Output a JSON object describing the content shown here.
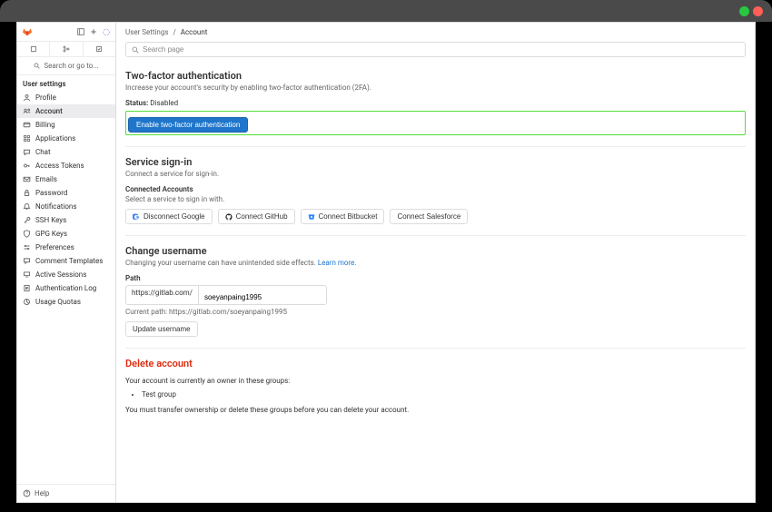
{
  "breadcrumb": {
    "root": "User Settings",
    "current": "Account"
  },
  "search": {
    "placeholder": "Search page"
  },
  "sidebar": {
    "search_label": "Search or go to...",
    "section_label": "User settings",
    "items": [
      {
        "label": "Profile"
      },
      {
        "label": "Account"
      },
      {
        "label": "Billing"
      },
      {
        "label": "Applications"
      },
      {
        "label": "Chat"
      },
      {
        "label": "Access Tokens"
      },
      {
        "label": "Emails"
      },
      {
        "label": "Password"
      },
      {
        "label": "Notifications"
      },
      {
        "label": "SSH Keys"
      },
      {
        "label": "GPG Keys"
      },
      {
        "label": "Preferences"
      },
      {
        "label": "Comment Templates"
      },
      {
        "label": "Active Sessions"
      },
      {
        "label": "Authentication Log"
      },
      {
        "label": "Usage Quotas"
      }
    ],
    "help_label": "Help"
  },
  "twofa": {
    "title": "Two-factor authentication",
    "desc": "Increase your account's security by enabling two-factor authentication (2FA).",
    "status_label": "Status:",
    "status_value": "Disabled",
    "enable_btn": "Enable two-factor authentication"
  },
  "signin": {
    "title": "Service sign-in",
    "desc": "Connect a service for sign-in.",
    "connected_title": "Connected Accounts",
    "connected_desc": "Select a service to sign in with.",
    "google": "Disconnect Google",
    "github": "Connect GitHub",
    "bitbucket": "Connect Bitbucket",
    "salesforce": "Connect Salesforce"
  },
  "username": {
    "title": "Change username",
    "desc_a": "Changing your username can have unintended side effects.",
    "desc_link": "Learn more",
    "field_label": "Path",
    "prefix": "https://gitlab.com/",
    "value": "soeyanpaing1995",
    "current_path": "Current path: https://gitlab.com/soeyanpaing1995",
    "update_btn": "Update username"
  },
  "del": {
    "title": "Delete account",
    "owner_line": "Your account is currently an owner in these groups:",
    "groups": [
      "Test group"
    ],
    "transfer_line": "You must transfer ownership or delete these groups before you can delete your account."
  }
}
